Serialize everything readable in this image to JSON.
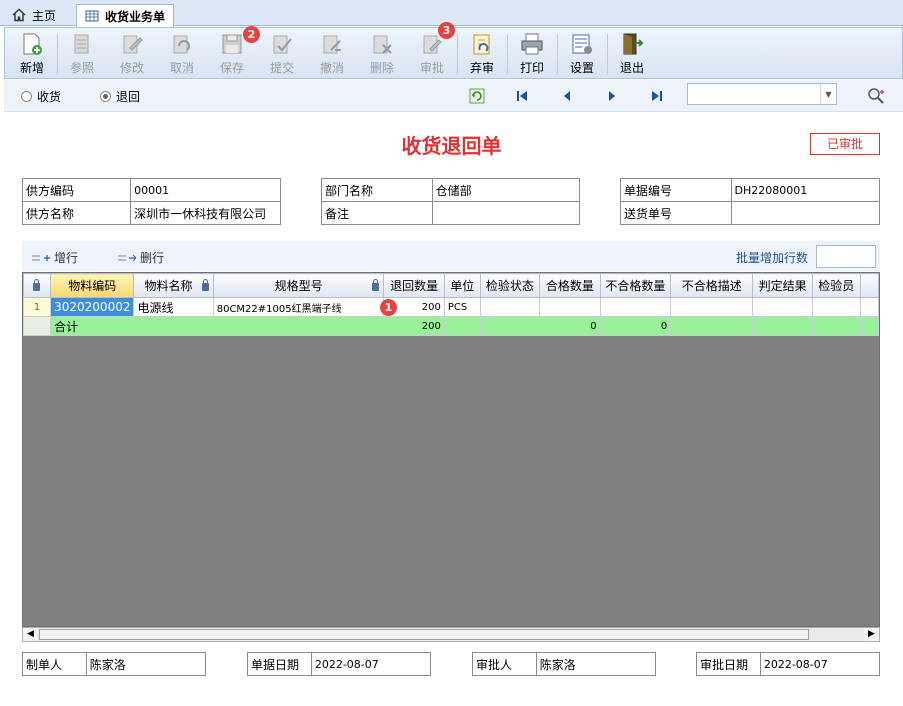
{
  "tabs": {
    "home": "主页",
    "active": "收货业务单"
  },
  "toolbar": {
    "buttons": [
      "新增",
      "参照",
      "修改",
      "取消",
      "保存",
      "提交",
      "撤消",
      "删除",
      "审批",
      "弃审",
      "打印",
      "设置",
      "退出"
    ],
    "badges": {
      "save": "2",
      "approve": "3"
    }
  },
  "radios": {
    "receive": "收货",
    "return": "退回",
    "selected": "退回"
  },
  "doc": {
    "title": "收货退回单",
    "status": "已审批"
  },
  "info": {
    "supplier_code_label": "供方编码",
    "supplier_code": "00001",
    "supplier_name_label": "供方名称",
    "supplier_name": "深圳市一休科技有限公司",
    "dept_label": "部门名称",
    "dept": "仓储部",
    "remark_label": "备注",
    "remark": "",
    "doc_no_label": "单据编号",
    "doc_no": "DH22080001",
    "delivery_label": "送货单号",
    "delivery": ""
  },
  "gridbar": {
    "add_row": "增行",
    "del_row": "删行",
    "batch_label": "批量增加行数",
    "batch_value": ""
  },
  "grid": {
    "columns": [
      "物料编码",
      "物料名称",
      "规格型号",
      "退回数量",
      "单位",
      "检验状态",
      "合格数量",
      "不合格数量",
      "不合格描述",
      "判定结果",
      "检验员"
    ],
    "rows": [
      {
        "no": "1",
        "code": "3020200002",
        "name": "电源线",
        "spec": "80CM22#1005红黑端子线",
        "qty": "200",
        "unit": "PCS",
        "status": "",
        "pass": "",
        "fail": "",
        "fail_desc": "",
        "result": "",
        "inspector": ""
      }
    ],
    "total": {
      "label": "合计",
      "qty": "200",
      "pass": "0",
      "fail": "0"
    },
    "row_badge": "1"
  },
  "footer": {
    "maker_label": "制单人",
    "maker": "陈家洛",
    "doc_date_label": "单据日期",
    "doc_date": "2022-08-07",
    "approver_label": "审批人",
    "approver": "陈家洛",
    "approve_date_label": "审批日期",
    "approve_date": "2022-08-07"
  },
  "colors": {
    "accent": "#e23030",
    "selected": "#3d8ee2",
    "total_row": "#98f098",
    "grid_bg": "#808080"
  }
}
